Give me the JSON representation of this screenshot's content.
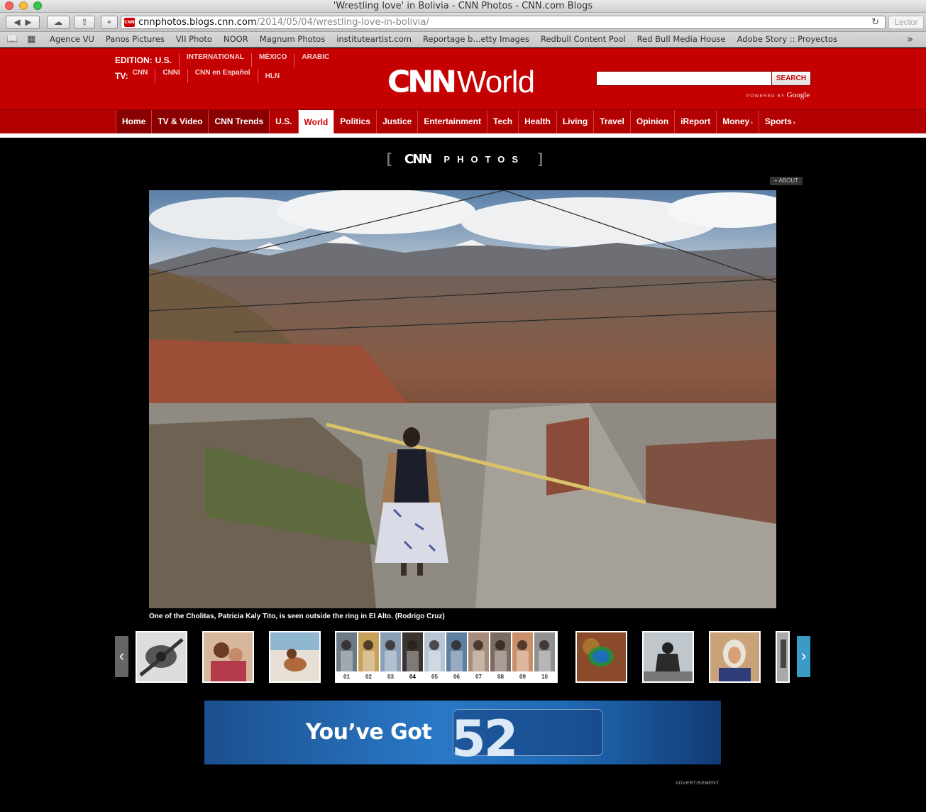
{
  "window": {
    "title": "'Wrestling love' in Bolivia - CNN Photos - CNN.com Blogs"
  },
  "toolbar": {
    "url_host": "cnnphotos.blogs.cnn.com",
    "url_path": "/2014/05/04/wrestling-love-in-bolivia/",
    "favicon_text": "CNN",
    "reader_label": "Lector",
    "new_tab_label": "+"
  },
  "bookmarks": [
    "Agence VU",
    "Panos Pictures",
    "VII Photo",
    "NOOR",
    "Magnum Photos",
    "instituteartist.com",
    "Reportage b...etty Images",
    "Redbull Content Pool",
    "Red Bull Media House",
    "Adobe Story :: Proyectos"
  ],
  "header": {
    "edition_label": "EDITION:",
    "edition_current": "U.S.",
    "edition_links": [
      "INTERNATIONAL",
      "MÉXICO",
      "ARABIC"
    ],
    "tv_label": "TV:",
    "tv_links": [
      "CNN",
      "CNNI",
      "CNN en Español",
      "HLN"
    ],
    "logo_cnn": "CNN",
    "logo_section": "World",
    "search_button": "SEARCH",
    "powered_by": "POWERED BY",
    "google": "Google"
  },
  "nav": [
    {
      "label": "Home",
      "state": "dark"
    },
    {
      "label": "TV & Video",
      "state": "dark"
    },
    {
      "label": "CNN Trends",
      "state": "dark"
    },
    {
      "label": "U.S.",
      "state": "normal"
    },
    {
      "label": "World",
      "state": "active"
    },
    {
      "label": "Politics",
      "state": "normal"
    },
    {
      "label": "Justice",
      "state": "normal"
    },
    {
      "label": "Entertainment",
      "state": "normal"
    },
    {
      "label": "Tech",
      "state": "normal"
    },
    {
      "label": "Health",
      "state": "normal"
    },
    {
      "label": "Living",
      "state": "normal"
    },
    {
      "label": "Travel",
      "state": "normal"
    },
    {
      "label": "Opinion",
      "state": "normal"
    },
    {
      "label": "iReport",
      "state": "normal"
    },
    {
      "label": "Money",
      "state": "normal",
      "arrow": "›"
    },
    {
      "label": "Sports",
      "state": "normal",
      "arrow": "›"
    }
  ],
  "gallery": {
    "banner_left": "[",
    "banner_logo": "CNN",
    "banner_word": "PHOTOS",
    "banner_right": "]",
    "about_label": "+ ABOUT",
    "caption": "One of the Cholitas, Patricia Kaly Tito, is seen outside the ring in El Alto. (Rodrigo Cruz)",
    "group_numbers": [
      "01",
      "02",
      "03",
      "04",
      "05",
      "06",
      "07",
      "08",
      "09",
      "10"
    ],
    "active_index": 4
  },
  "ad": {
    "headline": "You’ve Got",
    "number": "52",
    "label": "ADVERTISEMENT"
  },
  "colors": {
    "cnn_red": "#c50000",
    "nav_red": "#b30000",
    "accent_blue": "#3a9bc7"
  }
}
